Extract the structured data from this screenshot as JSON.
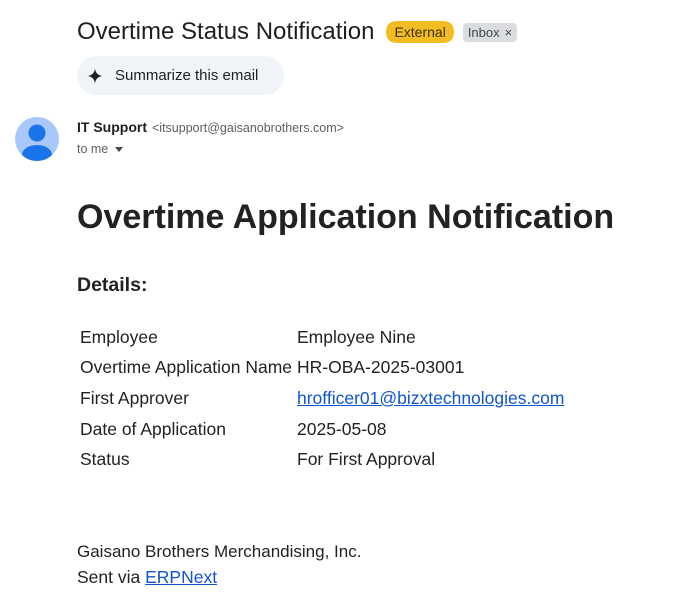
{
  "email": {
    "subject": "Overtime Status Notification",
    "labels": {
      "external": "External",
      "inbox": "Inbox",
      "inbox_remove": "×"
    },
    "summarize_label": "Summarize this email",
    "sender": {
      "name": "IT Support",
      "email": "<itsupport@gaisanobrothers.com>",
      "to": "to me"
    }
  },
  "body": {
    "heading": "Overtime Application Notification",
    "details_title": "Details:",
    "rows": [
      {
        "label": "Employee",
        "value": "Employee Nine"
      },
      {
        "label": "Overtime Application Name",
        "value": "HR-OBA-2025-03001"
      },
      {
        "label": "First Approver",
        "value": "hrofficer01@bizxtechnologies.com"
      },
      {
        "label": "Date of Application",
        "value": "2025-05-08"
      },
      {
        "label": "Status",
        "value": "For First Approval"
      }
    ],
    "company": "Gaisano Brothers Merchandising, Inc.",
    "sent_via_prefix": "Sent via ",
    "sent_via_link": "ERPNext"
  },
  "colors": {
    "external_badge": "#f2bd22",
    "inbox_badge": "#dadce0",
    "avatar": "#a8c7fa",
    "avatar_figure": "#1a73e8",
    "link": "#1155cc"
  },
  "icons": {
    "summarize": "sparkle-icon",
    "avatar": "person-avatar-icon",
    "recipients_caret": "caret-down-icon"
  }
}
